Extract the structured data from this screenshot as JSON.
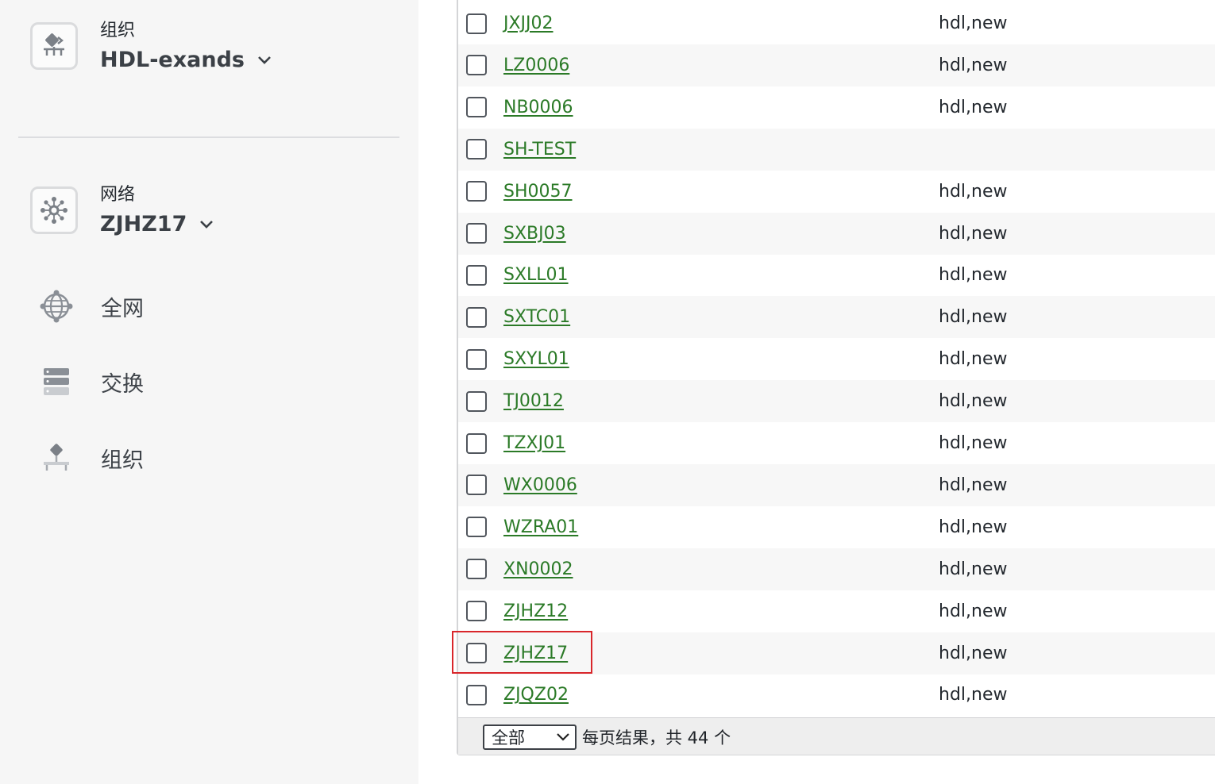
{
  "sidebar": {
    "org_context": {
      "label": "组织",
      "value": "HDL-exands",
      "icon": "organization-icon"
    },
    "network_context": {
      "label": "网络",
      "value": "ZJHZ17",
      "icon": "network-icon"
    },
    "nav": [
      {
        "label": "全网",
        "icon": "globe-network-icon"
      },
      {
        "label": "交换",
        "icon": "switch-stack-icon"
      },
      {
        "label": "组织",
        "icon": "organization-icon"
      }
    ]
  },
  "table": {
    "rows": [
      {
        "name": "JXJJ02",
        "tags": "hdl,new"
      },
      {
        "name": "LZ0006",
        "tags": "hdl,new"
      },
      {
        "name": "NB0006",
        "tags": "hdl,new"
      },
      {
        "name": "SH-TEST",
        "tags": ""
      },
      {
        "name": "SH0057",
        "tags": "hdl,new"
      },
      {
        "name": "SXBJ03",
        "tags": "hdl,new"
      },
      {
        "name": "SXLL01",
        "tags": "hdl,new"
      },
      {
        "name": "SXTC01",
        "tags": "hdl,new"
      },
      {
        "name": "SXYL01",
        "tags": "hdl,new"
      },
      {
        "name": "TJ0012",
        "tags": "hdl,new"
      },
      {
        "name": "TZXJ01",
        "tags": "hdl,new"
      },
      {
        "name": "WX0006",
        "tags": "hdl,new"
      },
      {
        "name": "WZRA01",
        "tags": "hdl,new"
      },
      {
        "name": "XN0002",
        "tags": "hdl,new"
      },
      {
        "name": "ZJHZ12",
        "tags": "hdl,new"
      },
      {
        "name": "ZJHZ17",
        "tags": "hdl,new",
        "highlighted": true
      },
      {
        "name": "ZJQZ02",
        "tags": "hdl,new"
      }
    ],
    "footer": {
      "page_size_selected": "全部",
      "results_text": "每页结果，共 44 个"
    }
  },
  "colors": {
    "link": "#2b7a27",
    "highlight_border": "#d9262b",
    "sidebar_bg": "#f6f6f6",
    "row_alt_bg": "#f7f7f7"
  }
}
